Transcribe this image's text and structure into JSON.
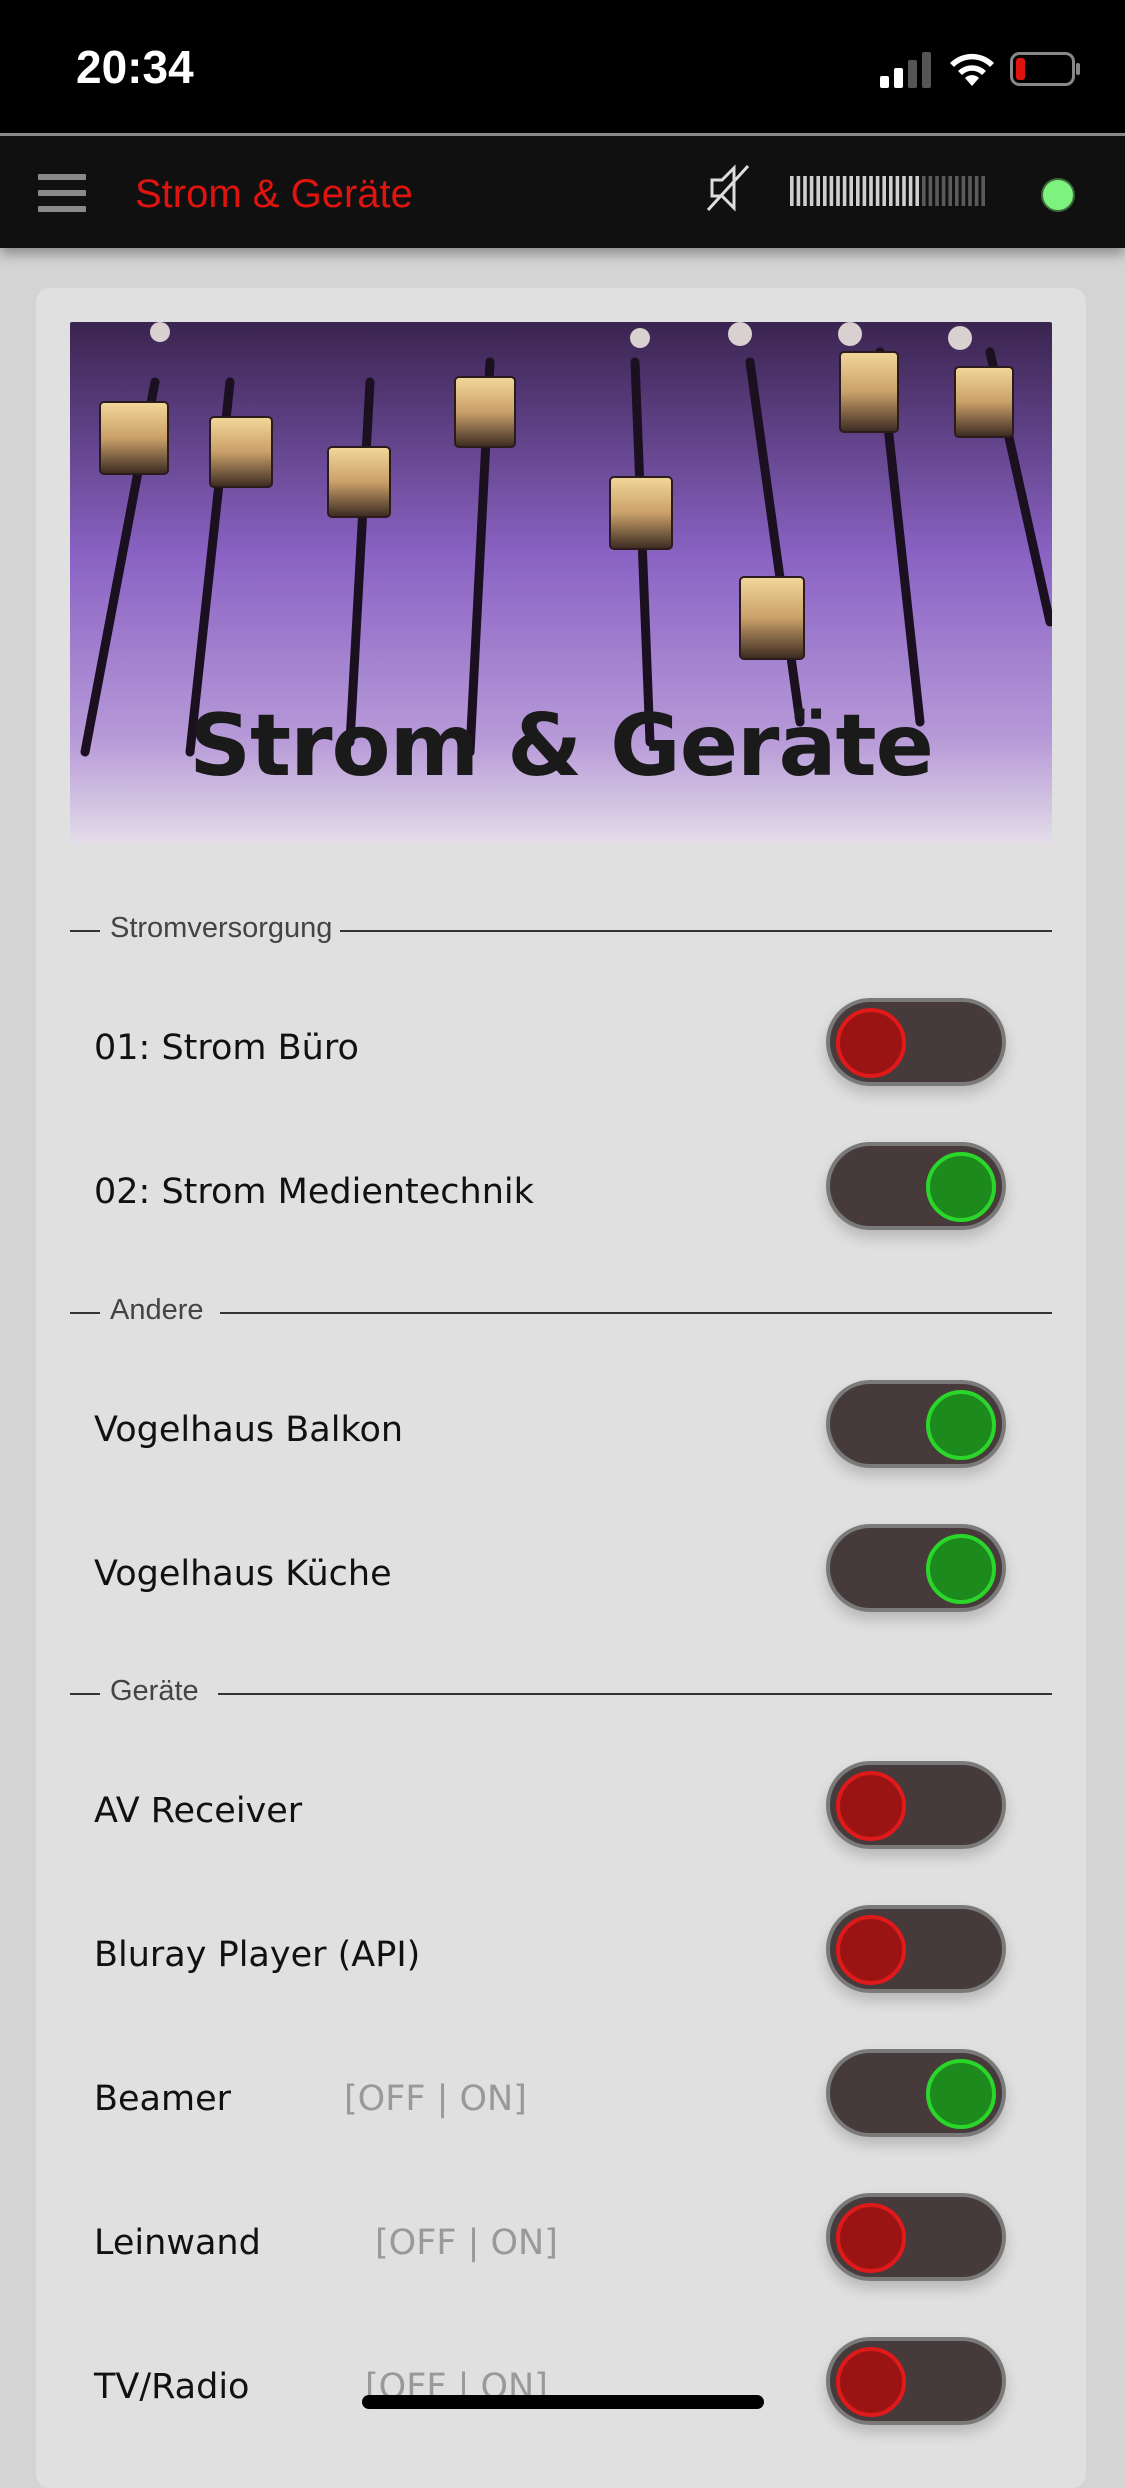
{
  "status_bar": {
    "time": "20:34"
  },
  "app_bar": {
    "title": "Strom & Geräte"
  },
  "hero": {
    "title": "Strom & Geräte"
  },
  "sections": [
    {
      "label": "Stromversorgung",
      "items": [
        {
          "name": "01: Strom Büro",
          "hint": "",
          "state": "off"
        },
        {
          "name": "02: Strom Medientechnik",
          "hint": "",
          "state": "on"
        }
      ]
    },
    {
      "label": "Andere",
      "items": [
        {
          "name": "Vogelhaus Balkon",
          "hint": "",
          "state": "on"
        },
        {
          "name": "Vogelhaus Küche",
          "hint": "",
          "state": "on"
        }
      ]
    },
    {
      "label": "Geräte",
      "items": [
        {
          "name": "AV Receiver",
          "hint": "",
          "state": "off"
        },
        {
          "name": "Bluray Player (API)",
          "hint": "",
          "state": "off"
        },
        {
          "name": "Beamer",
          "hint": "[OFF | ON]",
          "state": "on"
        },
        {
          "name": "Leinwand",
          "hint": "[OFF | ON]",
          "state": "off"
        },
        {
          "name": "TV/Radio",
          "hint": "[OFF | ON]",
          "state": "off"
        }
      ]
    }
  ],
  "colors": {
    "title_red": "#e0140f",
    "toggle_on": "#1c8a1c",
    "toggle_off": "#9b1414",
    "connection_ok": "#7ef27e"
  },
  "icons": [
    "hamburger-icon",
    "mute-icon",
    "volume-meter",
    "connection-status-dot",
    "cellular-signal-icon",
    "wifi-icon",
    "battery-icon"
  ]
}
